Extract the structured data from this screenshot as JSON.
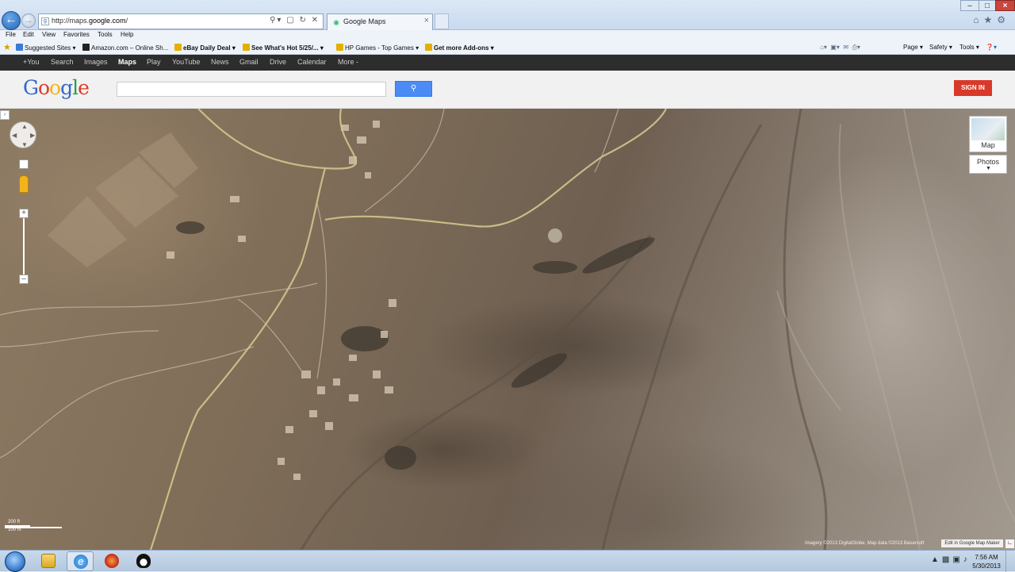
{
  "browser": {
    "address": {
      "prefix": "http://maps.",
      "domain": "google.com",
      "suffix": "/"
    },
    "tab_title": "Google Maps",
    "menu": [
      "File",
      "Edit",
      "View",
      "Favorites",
      "Tools",
      "Help"
    ],
    "favorites": [
      {
        "label": "Suggested Sites ▾"
      },
      {
        "label": "Amazon.com – Online Sh..."
      },
      {
        "label": "eBay Daily Deal ▾"
      },
      {
        "label": "See What's Hot 5/25/... ▾"
      },
      {
        "label": "HP Games - Top Games ▾"
      },
      {
        "label": "Get more Add-ons ▾"
      }
    ],
    "command_bar": [
      "Page ▾",
      "Safety ▾",
      "Tools ▾"
    ]
  },
  "google_bar": {
    "items": [
      "+You",
      "Search",
      "Images",
      "Maps",
      "Play",
      "YouTube",
      "News",
      "Gmail",
      "Drive",
      "Calendar",
      "More -"
    ],
    "active": "Maps"
  },
  "header": {
    "logo_letters": [
      {
        "ch": "G",
        "color": "#3366cc"
      },
      {
        "ch": "o",
        "color": "#dd3b2a"
      },
      {
        "ch": "o",
        "color": "#f3b41b"
      },
      {
        "ch": "g",
        "color": "#3366cc"
      },
      {
        "ch": "l",
        "color": "#2a9d44"
      },
      {
        "ch": "e",
        "color": "#dd3b2a"
      }
    ],
    "search_value": "",
    "sign_in": "SIGN IN"
  },
  "map": {
    "view_buttons": {
      "map": "Map",
      "photos": "Photos"
    },
    "scale": {
      "imperial": "200 ft",
      "metric": "100 m"
    },
    "attribution": "Imagery ©2013 DigitalGlobe, Map data ©2013 Basarsoft",
    "edit_link": "Edit in Google Map Maker"
  },
  "taskbar": {
    "time": "7:56 AM",
    "date": "5/30/2013"
  },
  "colors": {
    "accent_blue": "#4b8bf4",
    "signin_red": "#d9392a",
    "gbar_bg": "#2d2d2d"
  }
}
